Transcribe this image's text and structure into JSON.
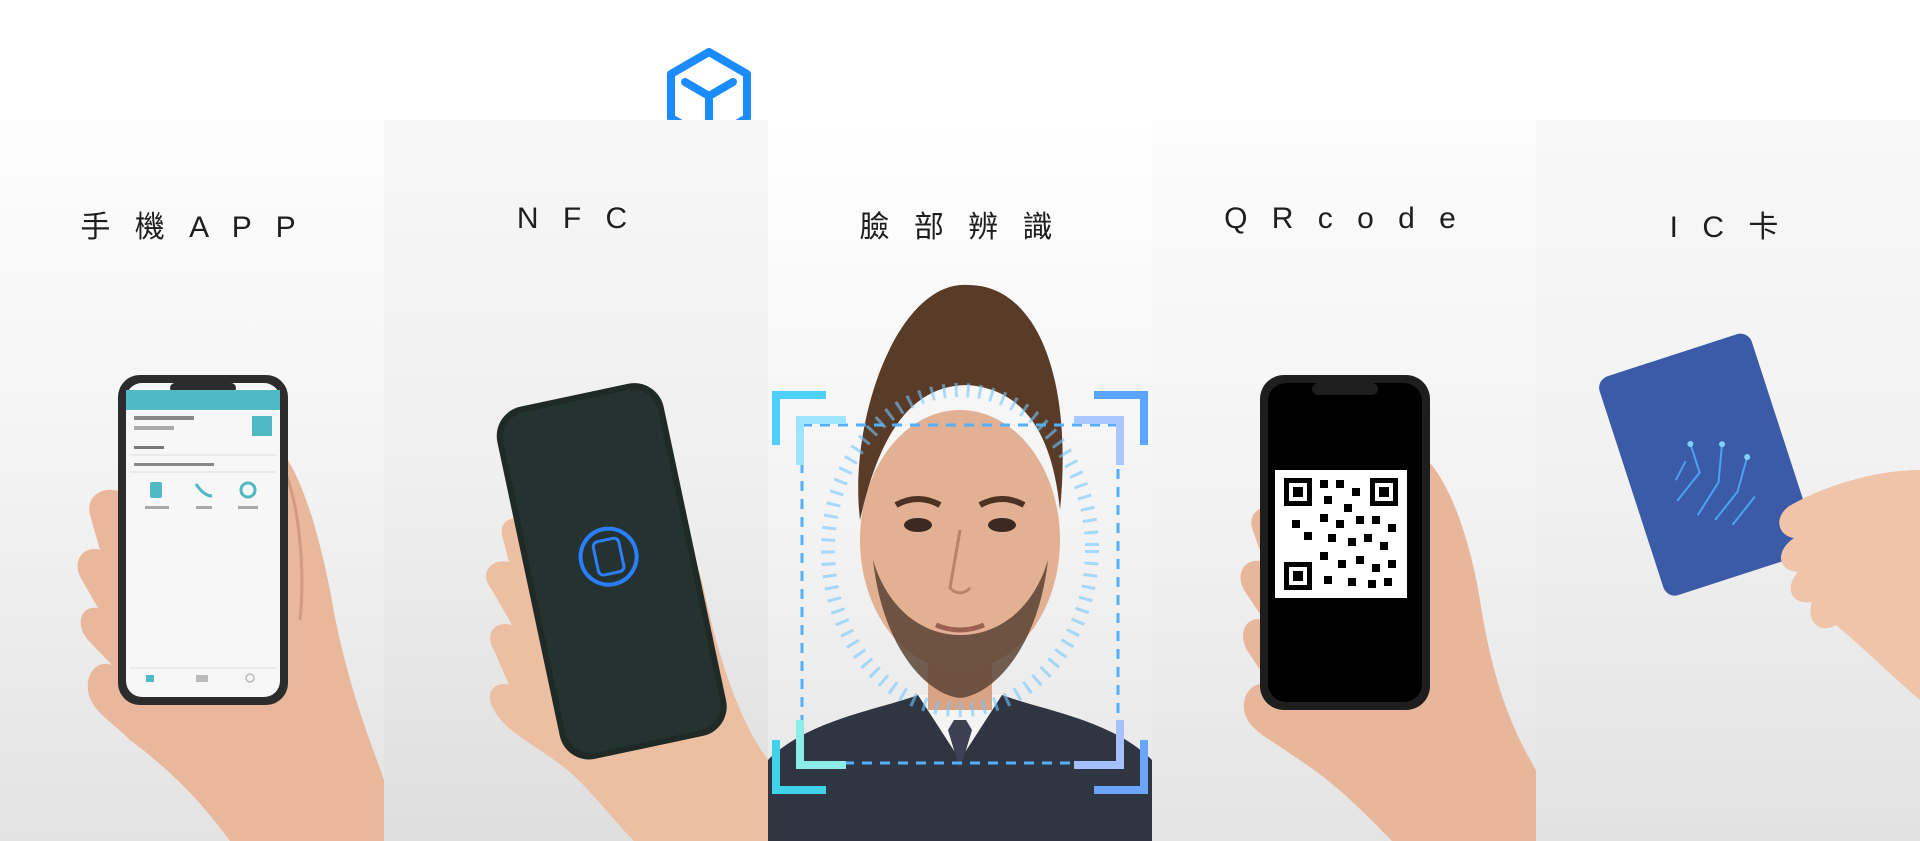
{
  "colors": {
    "brand_blue": "#1a8cff",
    "app_teal": "#4fb9c6",
    "nfc_ring": "#2a7fff",
    "face_frame": "#52b0ff",
    "card_blue": "#3b5ba8"
  },
  "logo": {
    "icon": "cube-icon"
  },
  "panels": [
    {
      "id": "app",
      "label": "手 機 A P P"
    },
    {
      "id": "nfc",
      "label": "N F C"
    },
    {
      "id": "face",
      "label": "臉 部 辨 識"
    },
    {
      "id": "qr",
      "label": "Q R  c o d e"
    },
    {
      "id": "ic",
      "label": "I C  卡"
    }
  ]
}
